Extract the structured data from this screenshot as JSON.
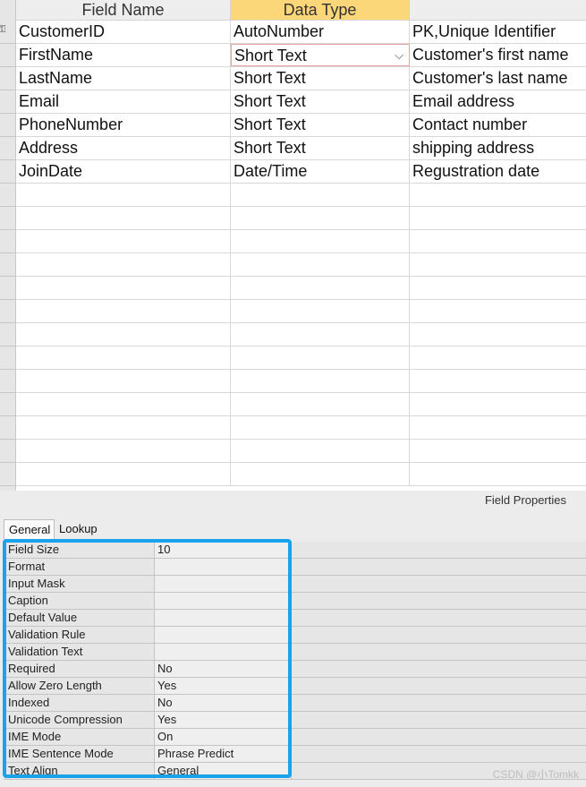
{
  "grid": {
    "headers": {
      "field_name": "Field Name",
      "data_type": "Data Type",
      "description": ""
    },
    "rows": [
      {
        "field": "CustomerID",
        "type": "AutoNumber",
        "desc": "PK,Unique Identifier"
      },
      {
        "field": "FirstName",
        "type": "Short Text",
        "desc": "Customer's first name"
      },
      {
        "field": "LastName",
        "type": "Short Text",
        "desc": "Customer's last name"
      },
      {
        "field": "Email",
        "type": "Short Text",
        "desc": "Email address"
      },
      {
        "field": "PhoneNumber",
        "type": "Short Text",
        "desc": "Contact number"
      },
      {
        "field": "Address",
        "type": "Short Text",
        "desc": "shipping address"
      },
      {
        "field": "JoinDate",
        "type": "Date/Time",
        "desc": "Regustration date"
      }
    ],
    "dropdown_icon": "chevron-down-icon",
    "primary_key_icon": "key-icon"
  },
  "properties": {
    "pane_title": "Field Properties",
    "tabs": [
      "General",
      "Lookup"
    ],
    "items": [
      {
        "name": "Field Size",
        "value": "10"
      },
      {
        "name": "Format",
        "value": ""
      },
      {
        "name": "Input Mask",
        "value": ""
      },
      {
        "name": "Caption",
        "value": ""
      },
      {
        "name": "Default Value",
        "value": ""
      },
      {
        "name": "Validation Rule",
        "value": ""
      },
      {
        "name": "Validation Text",
        "value": ""
      },
      {
        "name": "Required",
        "value": "No"
      },
      {
        "name": "Allow Zero Length",
        "value": "Yes"
      },
      {
        "name": "Indexed",
        "value": "No"
      },
      {
        "name": "Unicode Compression",
        "value": "Yes"
      },
      {
        "name": "IME Mode",
        "value": "On"
      },
      {
        "name": "IME Sentence Mode",
        "value": "Phrase Predict"
      },
      {
        "name": "Text Align",
        "value": "General"
      }
    ]
  },
  "watermark": "CSDN @小Tomkk",
  "colors": {
    "active_header": "#fcd77a",
    "highlight_border": "#1aa3ea",
    "edit_cell_border": "#e8a3a3"
  }
}
